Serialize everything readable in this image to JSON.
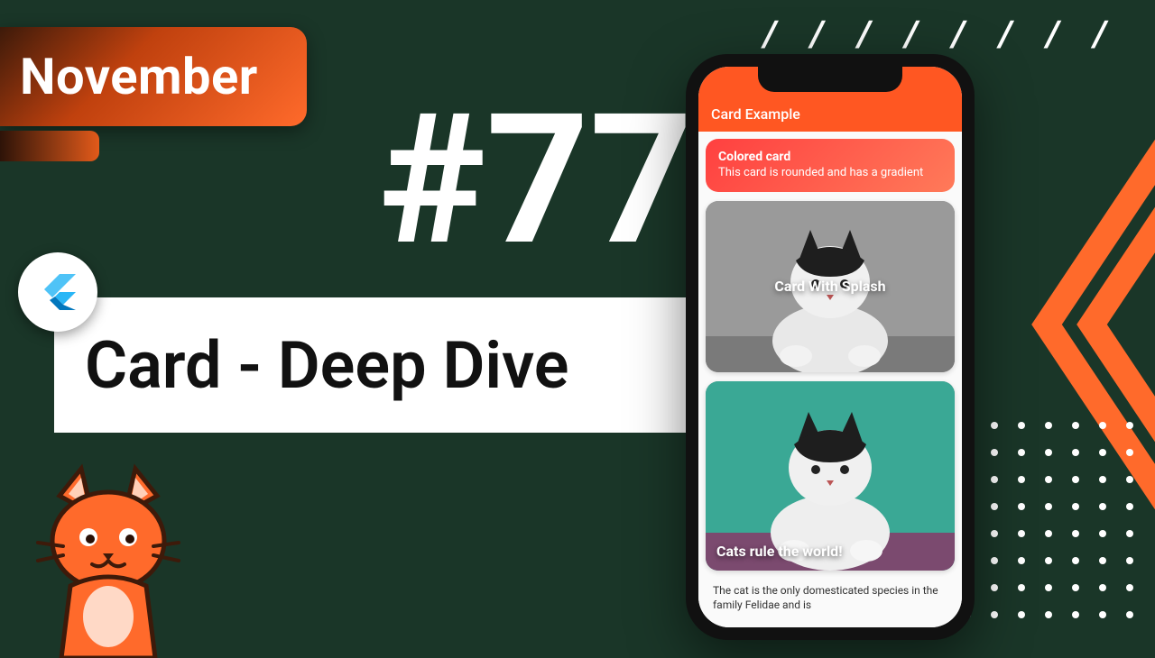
{
  "banner": {
    "month": "November"
  },
  "episode": {
    "number": "#77"
  },
  "title": {
    "text": "Card - Deep Dive"
  },
  "decor": {
    "slashes": "/ / / / / / / /"
  },
  "phone": {
    "appbar_title": "Card Example",
    "gradient_card": {
      "title": "Colored card",
      "subtitle": "This card is rounded and has a gradient"
    },
    "splash_card": {
      "label": "Card With Splash"
    },
    "hero_card": {
      "label": "Cats rule the world!"
    },
    "description": "The cat is the only domesticated species in the family Felidae and is"
  }
}
